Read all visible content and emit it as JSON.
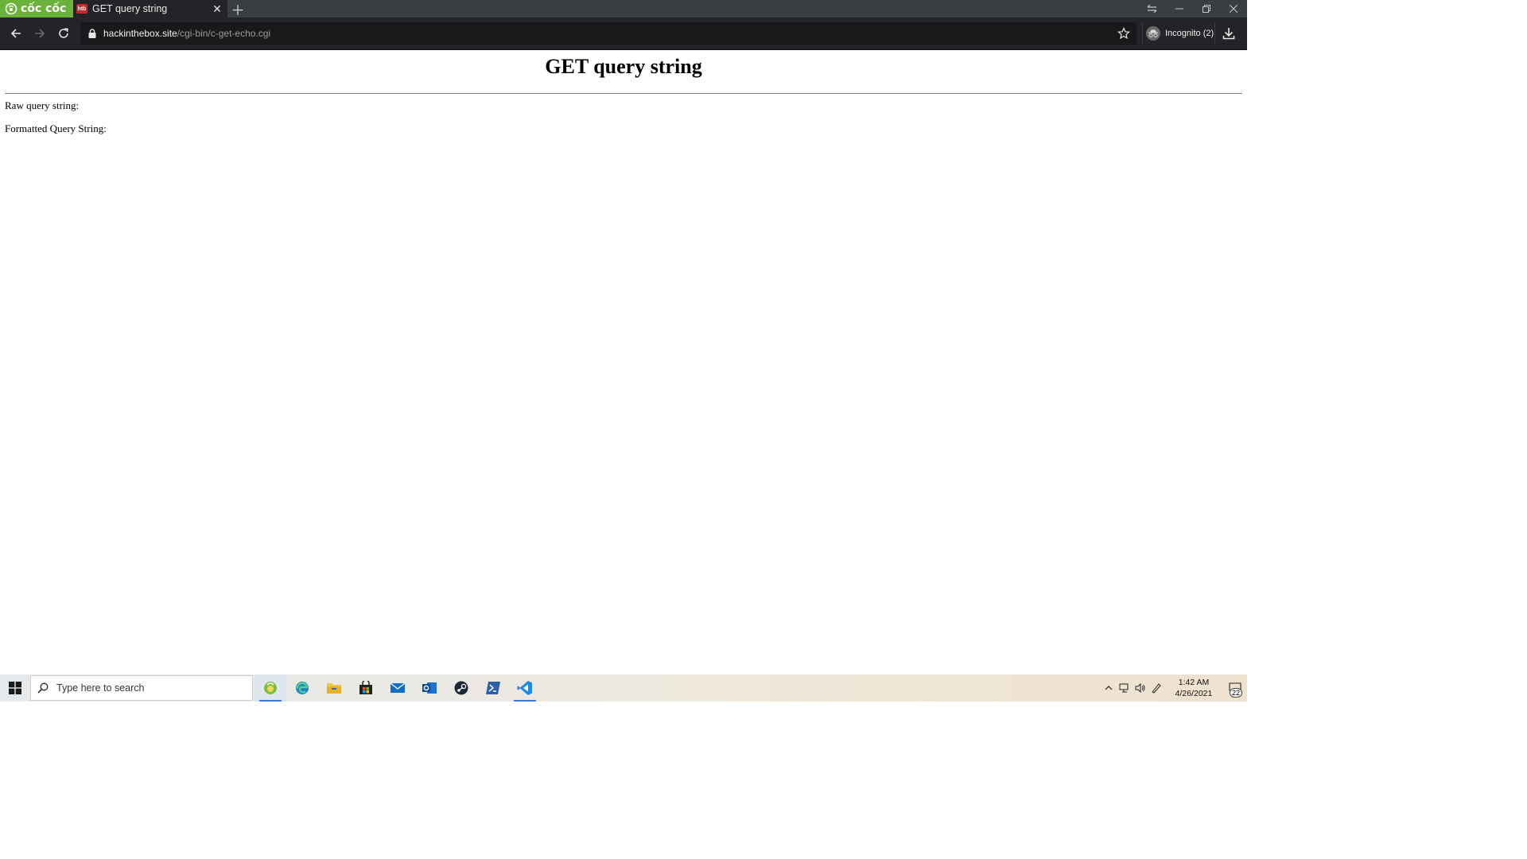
{
  "browser": {
    "brand": "cốc cốc",
    "tab": {
      "title": "GET query string",
      "favicon_text": "htb"
    },
    "address": {
      "host": "hackinthebox.site",
      "path": "/cgi-bin/c-get-echo.cgi"
    },
    "profile_label": "Incognito (2)"
  },
  "page": {
    "heading": "GET query string",
    "raw_label": "Raw query string:",
    "formatted_label": "Formatted Query String:"
  },
  "taskbar": {
    "search_placeholder": "Type here to search",
    "time": "1:42 AM",
    "date": "4/26/2021",
    "notification_count": "22"
  },
  "colors": {
    "brand_green": "#6ab23a",
    "chrome_dark": "#232427",
    "accent_blue": "#3a7bd5"
  }
}
